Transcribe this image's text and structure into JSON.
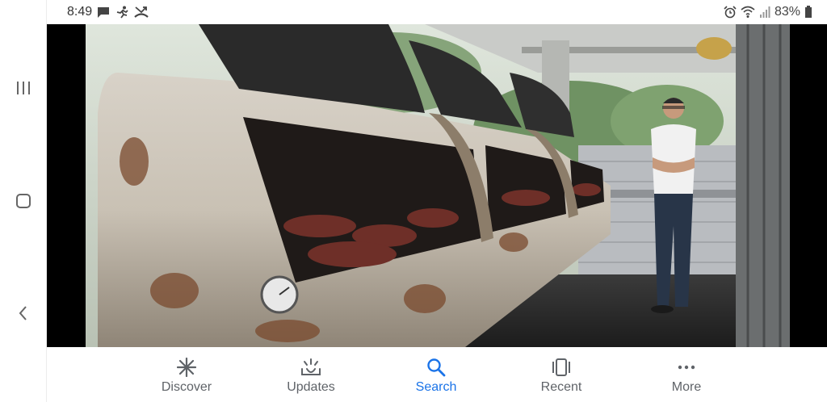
{
  "status_bar": {
    "time": "8:49",
    "left_icons": [
      "message-icon",
      "running-figure-icon",
      "missed-call-icon"
    ],
    "right_icons": [
      "alarm-icon",
      "wifi-icon",
      "cellular-signal-icon",
      "battery-icon"
    ],
    "battery_percent": "83%"
  },
  "system_nav": {
    "buttons": [
      "recent-apps",
      "home",
      "back"
    ]
  },
  "viewer": {
    "subject": "barbecue-smoker-photo"
  },
  "tab_bar": {
    "tabs": [
      {
        "label": "Discover",
        "icon": "asterisk-icon",
        "active": false
      },
      {
        "label": "Updates",
        "icon": "updates-icon",
        "active": false
      },
      {
        "label": "Search",
        "icon": "search-icon",
        "active": true
      },
      {
        "label": "Recent",
        "icon": "recent-cards-icon",
        "active": false
      },
      {
        "label": "More",
        "icon": "more-dots-icon",
        "active": false
      }
    ],
    "active_color": "#1a73e8",
    "inactive_color": "#5f6368"
  }
}
